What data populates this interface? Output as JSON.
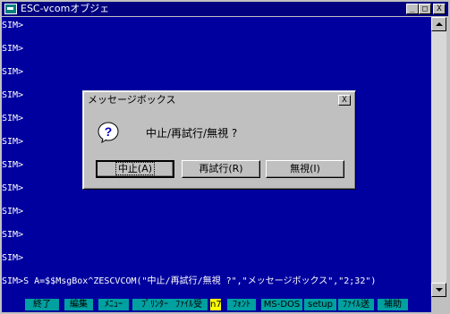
{
  "window": {
    "title": "ESC-vcomオブジェ",
    "minimize": "_",
    "maximize": "□",
    "close": "X"
  },
  "terminal": {
    "lines": [
      "SIM>",
      "SIM>",
      "SIM>",
      "SIM>",
      "SIM>",
      "SIM>",
      "SIM>",
      "SIM>",
      "SIM>",
      "SIM>",
      "SIM>"
    ],
    "command": "SIM>S A=$$MsgBox^ZESCVCOM(\"中止/再試行/無視 ?\",\"メッセージボックス\",\"2;32\")",
    "text_color": "#ffffff",
    "background": "#00009f"
  },
  "fkeys": [
    "終了",
    "編集",
    "ﾒﾆｭｰ",
    "ﾌﾟﾘﾝﾀｰ",
    "ﾌｧｲﾙ受",
    "n7",
    "ﾌｫﾝﾄ",
    "MS-DOS",
    "setup",
    "ﾌｧｲﾙ送",
    "補助"
  ],
  "dialog": {
    "title": "メッセージボックス",
    "close": "X",
    "icon": "question-icon",
    "message": "中止/再試行/無視 ?",
    "buttons": {
      "abort": "中止(A)",
      "retry": "再試行(R)",
      "ignore": "無視(I)"
    }
  }
}
